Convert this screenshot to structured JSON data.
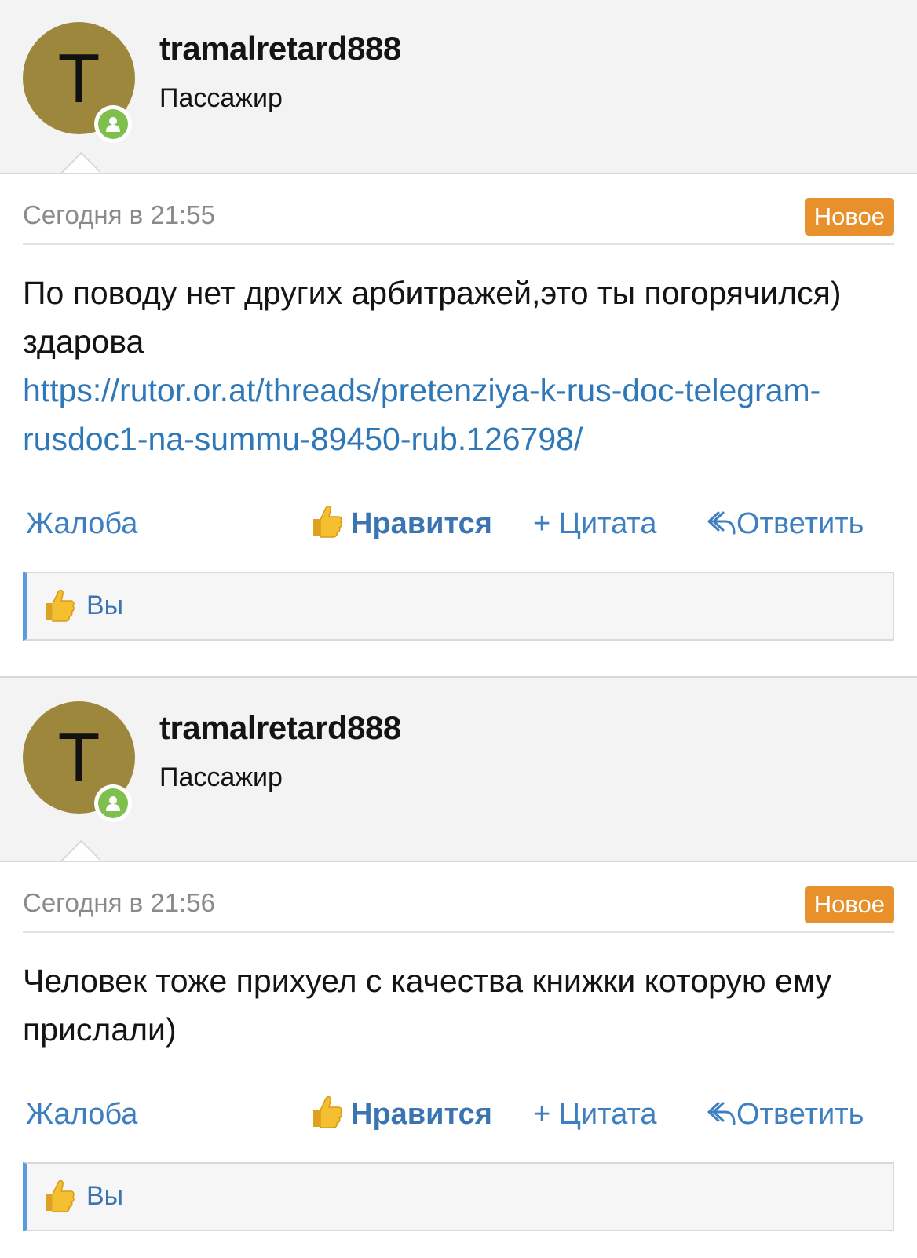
{
  "posts": [
    {
      "avatar_letter": "T",
      "username": "tramalretard888",
      "user_title": "Пассажир",
      "date": "Сегодня в 21:55",
      "badge": "Новое",
      "text_before_link": "По поводу нет других арбитражей,это ты погорячился) здарова",
      "link": "https://rutor.or.at/threads/pretenziya-k-rus-doc-telegram-rusdoc1-na-summu-89450-rub.126798/",
      "actions": {
        "report": "Жалоба",
        "like": "Нравится",
        "quote": "+ Цитата",
        "reply": "Ответить"
      },
      "liked_by": "Вы"
    },
    {
      "avatar_letter": "T",
      "username": "tramalretard888",
      "user_title": "Пассажир",
      "date": "Сегодня в 21:56",
      "badge": "Новое",
      "text": "Человек тоже прихуел с качества книжки которую ему прислали)",
      "actions": {
        "report": "Жалоба",
        "like": "Нравится",
        "quote": "+ Цитата",
        "reply": "Ответить"
      },
      "liked_by": "Вы"
    }
  ],
  "colors": {
    "header_bg": "#f3f3f3",
    "link": "#2f78b8",
    "badge": "#e8902c",
    "avatar": "#9c873d",
    "online": "#7fbf4d"
  },
  "icons": [
    "online-status-icon",
    "thumbs-up-icon",
    "reply-arrow-icon"
  ]
}
